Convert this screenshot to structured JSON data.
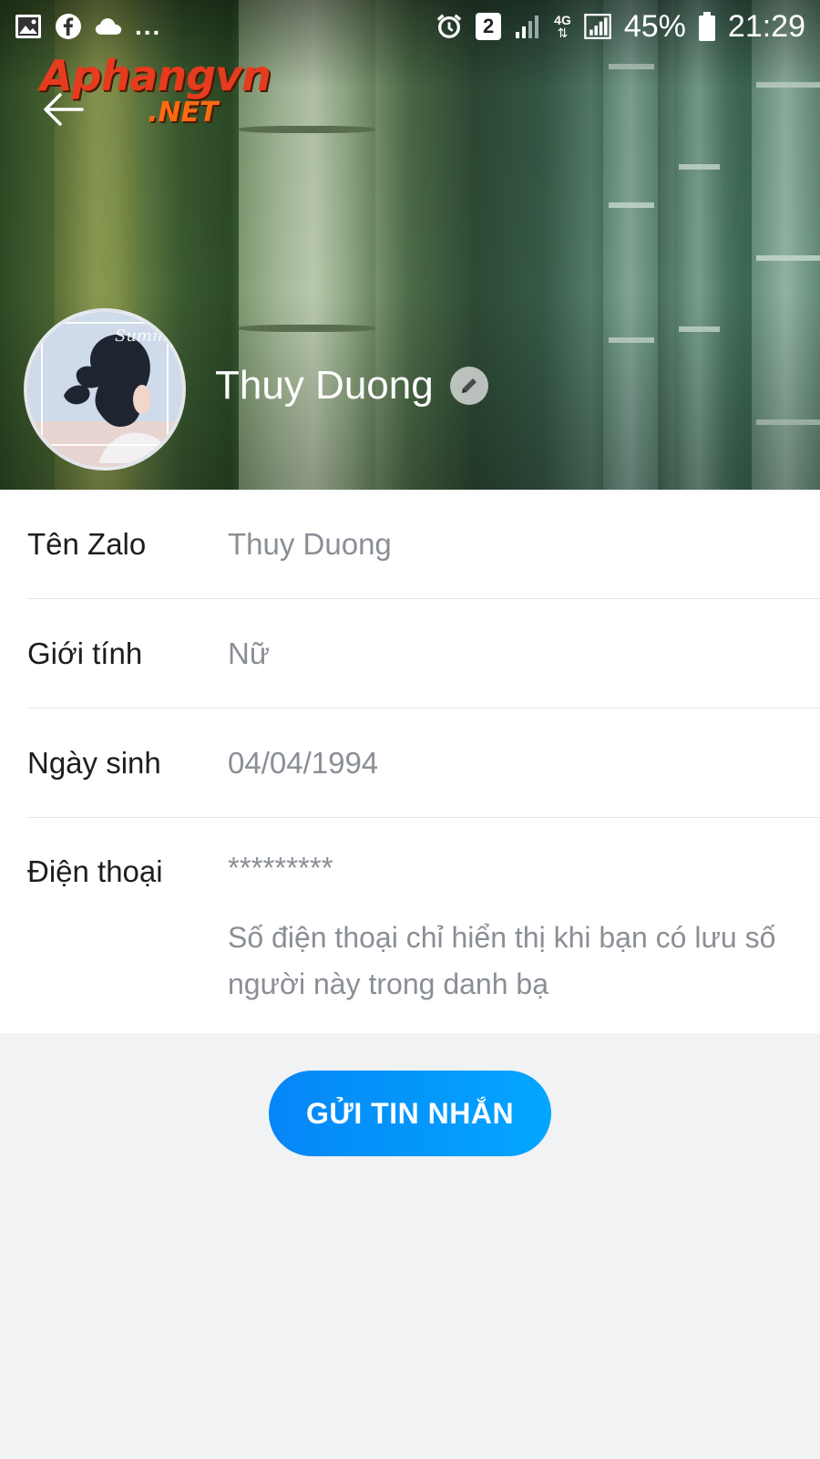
{
  "status_bar": {
    "left_icons": [
      "image-icon",
      "facebook-icon",
      "cloud-icon"
    ],
    "overflow": "...",
    "sim_badge": "2",
    "network": "4G",
    "battery": "45%",
    "time": "21:29"
  },
  "header": {
    "watermark_main": "Aphangvn",
    "watermark_sub": ".NET"
  },
  "profile": {
    "display_name": "Thuy Duong"
  },
  "info": {
    "rows": [
      {
        "label": "Tên Zalo",
        "value": "Thuy Duong"
      },
      {
        "label": "Giới tính",
        "value": "Nữ"
      },
      {
        "label": "Ngày sinh",
        "value": "04/04/1994"
      },
      {
        "label": "Điện thoại",
        "value": "*********",
        "note": "Số điện thoại chỉ hiển thị khi bạn có lưu số người này trong danh bạ"
      }
    ]
  },
  "actions": {
    "send_message_label": "GỬI TIN NHẮN"
  },
  "colors": {
    "accent_start": "#0686f7",
    "accent_end": "#03a6ff",
    "label_text": "#1d1d1f",
    "value_text": "#8a8f96",
    "page_bg": "#f1f2f4"
  }
}
